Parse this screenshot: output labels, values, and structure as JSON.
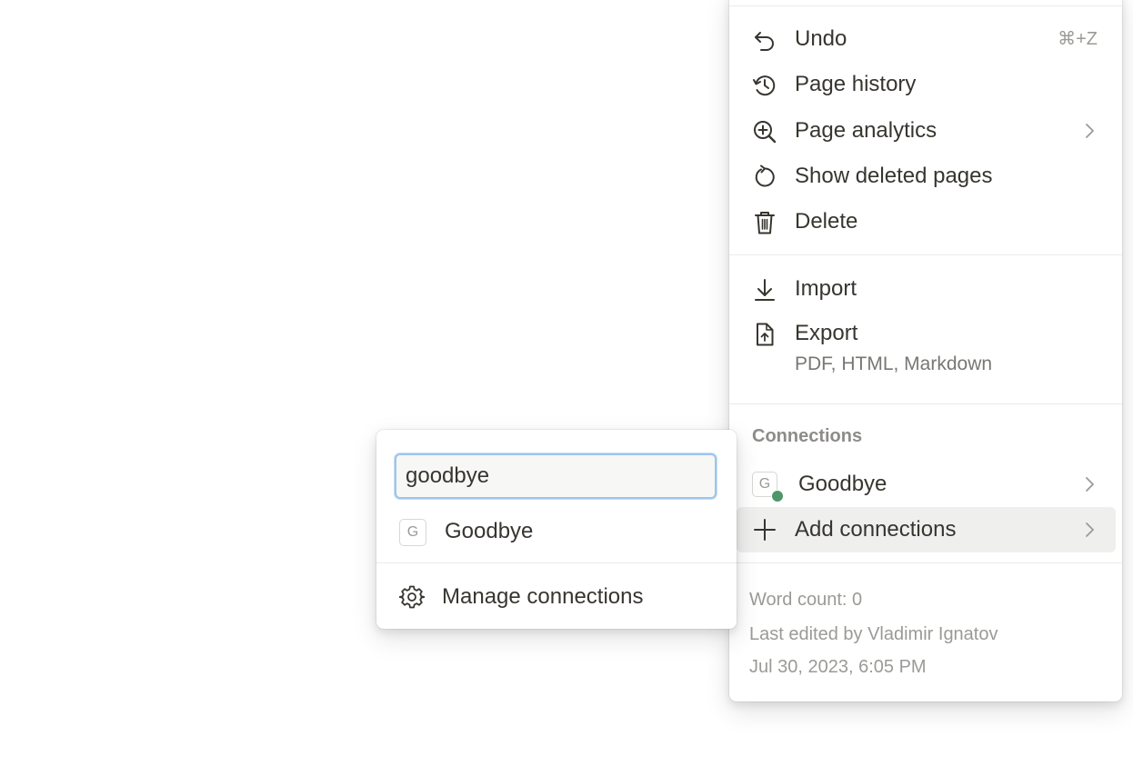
{
  "menu": {
    "items": [
      {
        "label": "Undo",
        "shortcut": "⌘+Z",
        "icon": "undo-icon"
      },
      {
        "label": "Page history",
        "icon": "history-icon"
      },
      {
        "label": "Page analytics",
        "icon": "zoom-in-icon",
        "submenu": true
      },
      {
        "label": "Show deleted pages",
        "icon": "restore-icon"
      },
      {
        "label": "Delete",
        "icon": "trash-icon"
      },
      {
        "label": "Import",
        "icon": "import-icon"
      },
      {
        "label": "Export",
        "sublabel": "PDF, HTML, Markdown",
        "icon": "export-icon"
      }
    ],
    "connections": {
      "heading": "Connections",
      "items": [
        {
          "label": "Goodbye",
          "badge": "G",
          "status_color": "#4f9768",
          "submenu": true
        },
        {
          "label": "Add connections",
          "icon": "plus-icon",
          "submenu": true,
          "highlighted": true
        }
      ]
    },
    "footer": {
      "word_count": "Word count: 0",
      "last_edited": "Last edited by Vladimir Ignatov",
      "timestamp": "Jul 30, 2023, 6:05 PM"
    }
  },
  "popover": {
    "search": {
      "value": "goodbye"
    },
    "results": [
      {
        "label": "Goodbye",
        "badge": "G"
      }
    ],
    "manage_label": "Manage connections"
  },
  "colors": {
    "text": "#37352f",
    "muted": "#9b9a97",
    "highlight": "#efefee",
    "focus_ring": "#9ec5ea",
    "status_green": "#4f9768"
  }
}
